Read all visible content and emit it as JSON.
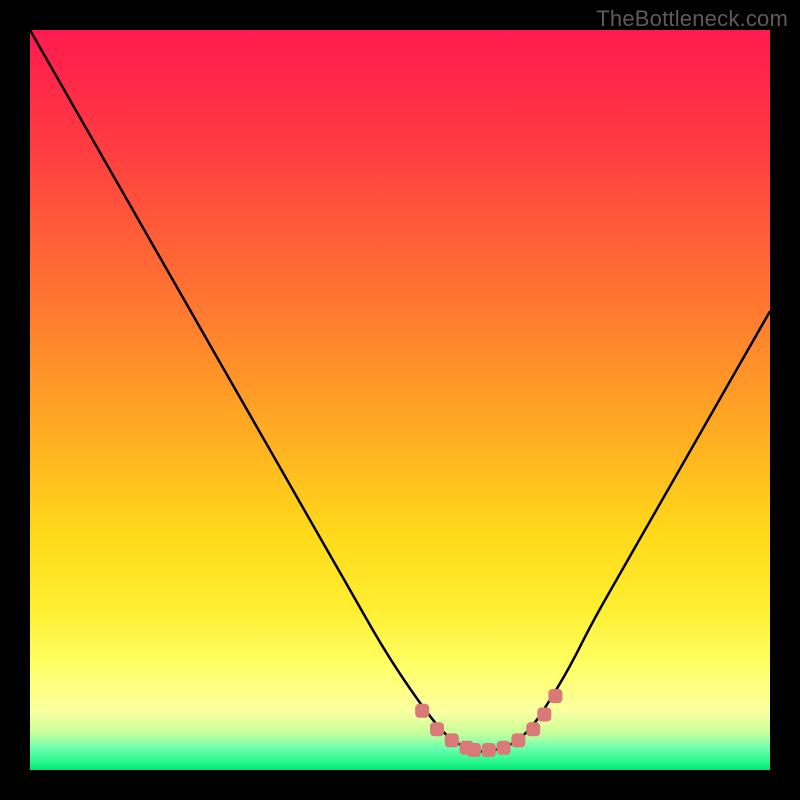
{
  "watermark": {
    "text": "TheBottleneck.com"
  },
  "colors": {
    "background": "#000000",
    "curve": "#000000",
    "marker": "#d97a78",
    "gradient_top": "#ff1a4f",
    "gradient_mid": "#ffd500",
    "gradient_bottom": "#00e676"
  },
  "chart_data": {
    "type": "line",
    "title": "",
    "xlabel": "",
    "ylabel": "",
    "xlim": [
      0,
      100
    ],
    "ylim": [
      0,
      100
    ],
    "grid": false,
    "legend": false,
    "series": [
      {
        "name": "bottleneck-curve",
        "x": [
          0,
          4,
          8,
          12,
          16,
          20,
          24,
          28,
          32,
          36,
          40,
          44,
          48,
          52,
          55,
          57,
          59,
          60,
          62,
          64,
          66,
          68,
          70,
          73,
          76,
          80,
          84,
          88,
          92,
          96,
          100
        ],
        "y": [
          100,
          93,
          86,
          79,
          72,
          65,
          58,
          51,
          44,
          37,
          30,
          23,
          16,
          10,
          6,
          4,
          3,
          2.5,
          2.5,
          3,
          4,
          6,
          9,
          14,
          20,
          27,
          34,
          41,
          48,
          55,
          62
        ]
      }
    ],
    "markers": {
      "name": "highlighted-points",
      "x": [
        53,
        55,
        57,
        59,
        60,
        62,
        64,
        66,
        68,
        69.5,
        71
      ],
      "y": [
        8,
        5.5,
        4,
        3,
        2.7,
        2.7,
        3,
        4,
        5.5,
        7.5,
        10
      ]
    },
    "background_gradient": {
      "orientation": "vertical",
      "stops": [
        {
          "pos": 0.0,
          "color": "#ff1a4f"
        },
        {
          "pos": 0.55,
          "color": "#ffae22"
        },
        {
          "pos": 0.86,
          "color": "#ffff66"
        },
        {
          "pos": 1.0,
          "color": "#00e676"
        }
      ]
    }
  }
}
